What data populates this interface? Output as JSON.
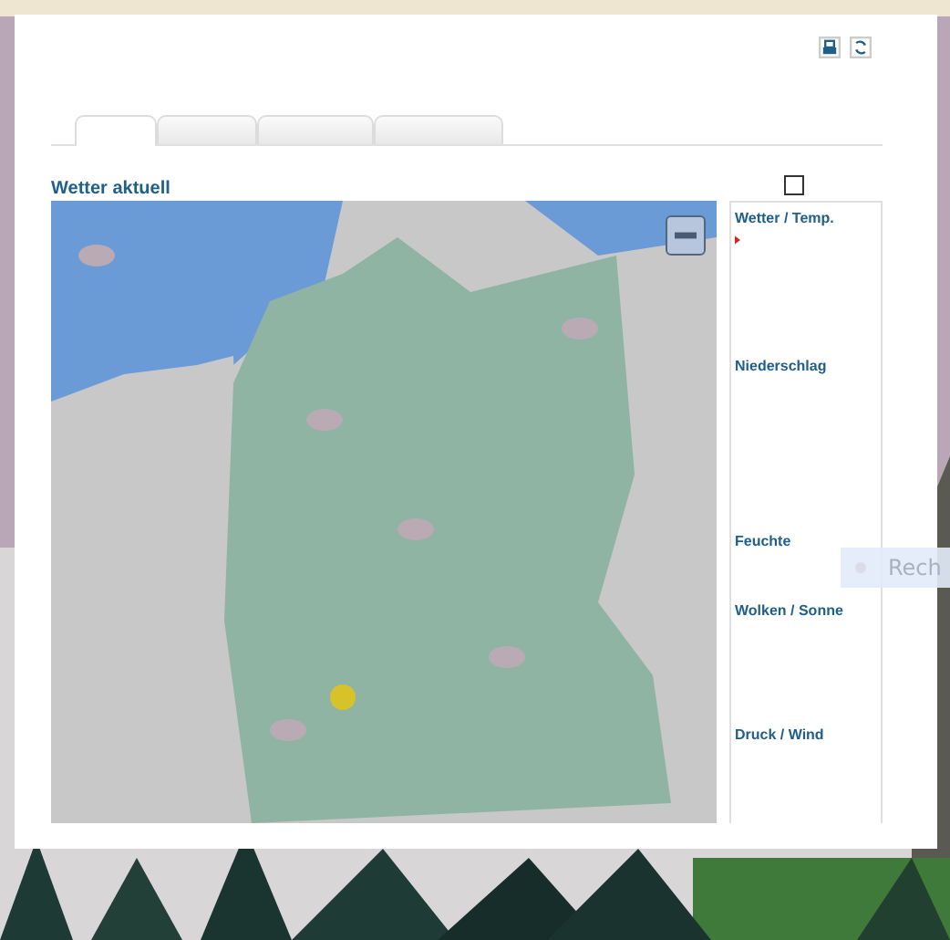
{
  "toolbar": {
    "icons": [
      {
        "kind": "print"
      },
      {
        "kind": "refresh"
      }
    ]
  },
  "tabs": [
    {
      "selected": true
    },
    {
      "selected": false
    },
    {
      "selected": false
    },
    {
      "selected": false
    }
  ],
  "section": {
    "title": "Wetter aktuell",
    "checkbox": {
      "checked": false
    }
  },
  "map": {
    "kind": "picture",
    "zoom_out": {
      "disabled": false
    }
  },
  "legend": [
    {
      "label": "Wetter / Temp.",
      "marker": true
    },
    {
      "label": "Niederschlag",
      "marker": false
    },
    {
      "label": "Feuchte",
      "marker": false
    },
    {
      "label": "Wolken / Sonne",
      "marker": false
    },
    {
      "label": "Druck / Wind",
      "marker": false
    }
  ],
  "overlay_button": {
    "label": "Rech"
  }
}
